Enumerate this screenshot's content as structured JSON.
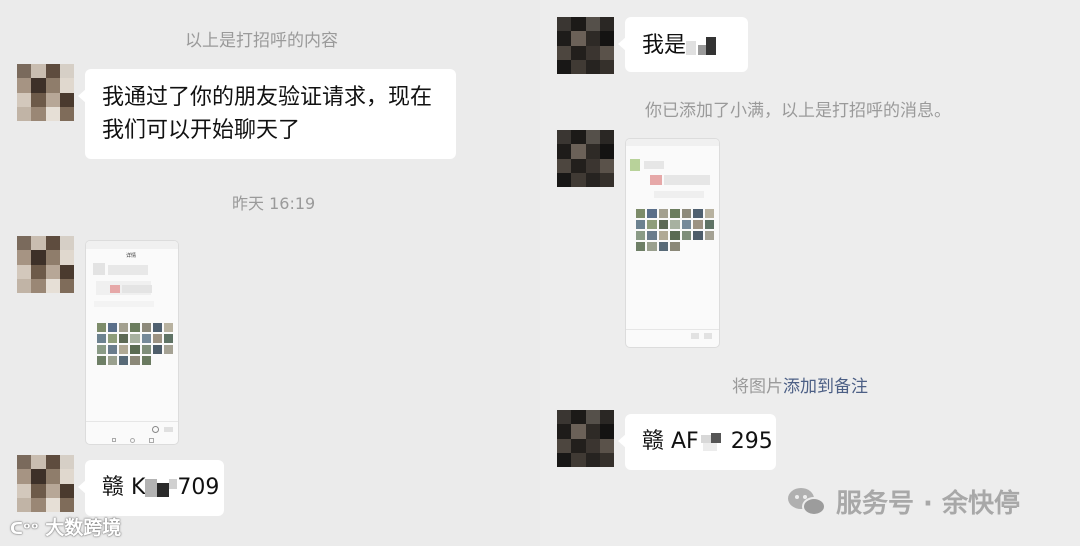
{
  "left_chat": {
    "system_greeting": "以上是打招呼的内容",
    "message_1": {
      "line1": "我通过了你的朋友验证请求，现在",
      "line2": "我们可以开始聊天了"
    },
    "timestamp": "昨天 16:19",
    "message_2": {
      "prefix": "赣 K",
      "suffix": "709"
    },
    "screenshot_thumb": {
      "title": "详情"
    }
  },
  "right_chat": {
    "message_1": {
      "prefix": "我是"
    },
    "system_added": "你已添加了小满，以上是打招呼的消息。",
    "image_action": {
      "prefix": "将图片",
      "link": "添加到备注"
    },
    "message_2": {
      "prefix": "赣 AF",
      "suffix": "295"
    }
  },
  "watermarks": {
    "left": "大数跨境",
    "right": "服务号 · 余快停"
  },
  "colors": {
    "background": "#ededed",
    "bubble": "#ffffff",
    "system_text": "#9a9a9a",
    "link": "#4c5f85"
  }
}
